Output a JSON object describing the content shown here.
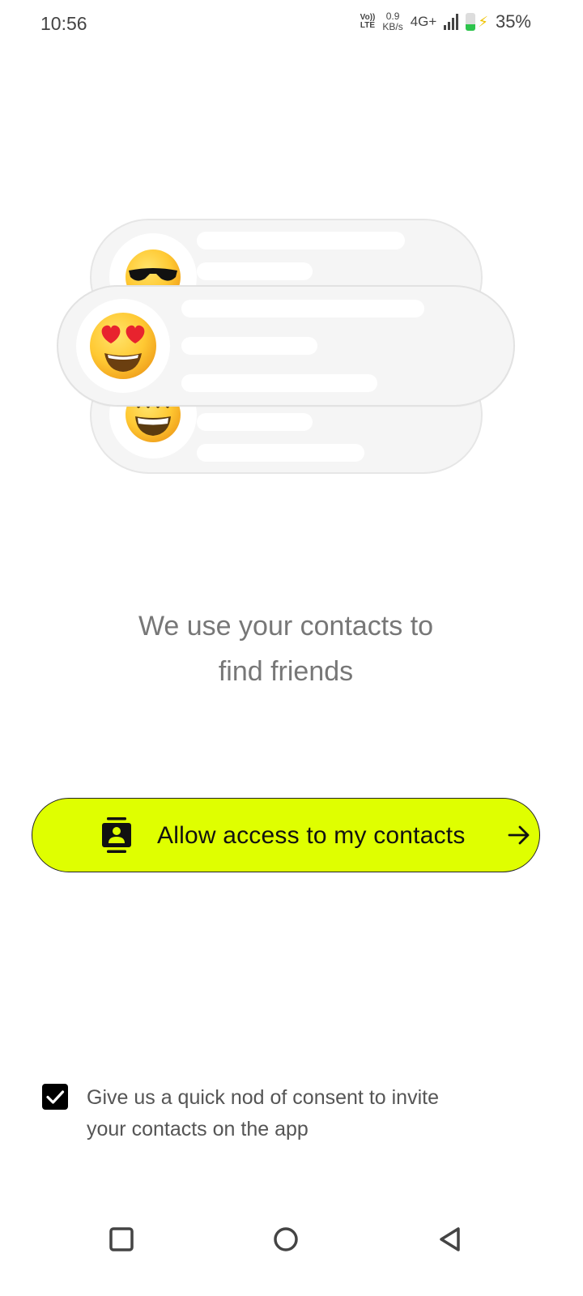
{
  "status_bar": {
    "time": "10:56",
    "volte_top": "Vo))",
    "volte_bottom": "LTE",
    "net_speed_value": "0.9",
    "net_speed_unit": "KB/s",
    "network_type": "4G+",
    "battery_percent": "35%",
    "battery_level": 0.35
  },
  "illustration": {
    "back_top_emoji": "smiling-face-with-sunglasses",
    "front_emoji": "smiling-face-with-heart-eyes",
    "back_bottom_emoji": "grinning-face-with-smiling-eyes"
  },
  "headline": {
    "line1": "We use your contacts to",
    "line2": "find friends"
  },
  "cta": {
    "label": "Allow access to my contacts",
    "icon": "contacts-book-icon",
    "arrow_icon": "arrow-right-icon",
    "background_color": "#dfff00"
  },
  "consent": {
    "checked": true,
    "line1": "Give us a quick nod of consent to invite",
    "line2": "your contacts on the app"
  },
  "nav_bar": {
    "recents_icon": "square-icon",
    "home_icon": "circle-icon",
    "back_icon": "triangle-back-icon"
  }
}
